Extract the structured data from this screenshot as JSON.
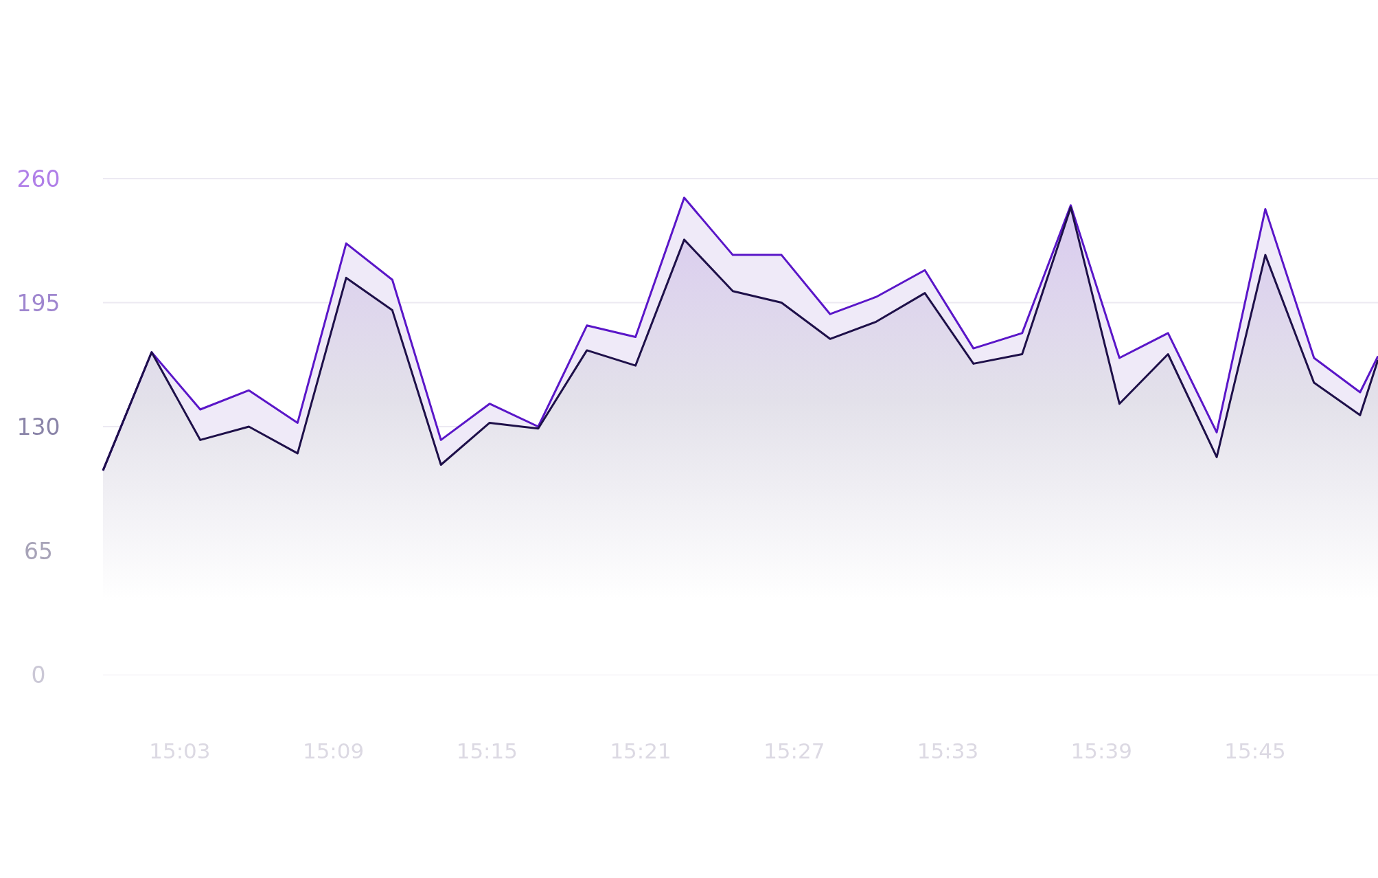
{
  "chart": {
    "chart_data": {
      "type": "area",
      "x": [
        900,
        901.9,
        903.8,
        905.7,
        907.6,
        909.5,
        911.3,
        913.2,
        915.1,
        917,
        918.9,
        920.8,
        922.7,
        924.6,
        926.5,
        928.4,
        930.2,
        932.1,
        934,
        935.9,
        937.8,
        939.7,
        941.6,
        943.5,
        945.4,
        947.3,
        949.1,
        949.8
      ],
      "series": [
        {
          "color": "#5a16c8",
          "values": [
            107,
            169,
            139,
            149,
            132,
            226,
            207,
            123,
            142,
            130,
            183,
            177,
            250,
            220,
            220,
            189,
            198,
            212,
            171,
            179,
            246,
            166,
            179,
            127,
            244,
            166,
            148,
            167
          ]
        },
        {
          "color": "#1e1049",
          "values": [
            107,
            169,
            123,
            130,
            116,
            208,
            191,
            110,
            132,
            129,
            170,
            162,
            228,
            201,
            195,
            176,
            185,
            200,
            163,
            168,
            245,
            142,
            168,
            114,
            220,
            153,
            136,
            165
          ]
        }
      ],
      "xlim": [
        900,
        949.8
      ],
      "ylim": [
        0,
        260
      ],
      "xticks": [
        {
          "value": 903,
          "label": "15:03"
        },
        {
          "value": 909,
          "label": "15:09"
        },
        {
          "value": 915,
          "label": "15:15"
        },
        {
          "value": 921,
          "label": "15:21"
        },
        {
          "value": 927,
          "label": "15:27"
        },
        {
          "value": 933,
          "label": "15:33"
        },
        {
          "value": 939,
          "label": "15:39"
        },
        {
          "value": 945,
          "label": "15:45"
        }
      ],
      "yticks": [
        0,
        65,
        130,
        195,
        260
      ],
      "stacked": false
    }
  }
}
